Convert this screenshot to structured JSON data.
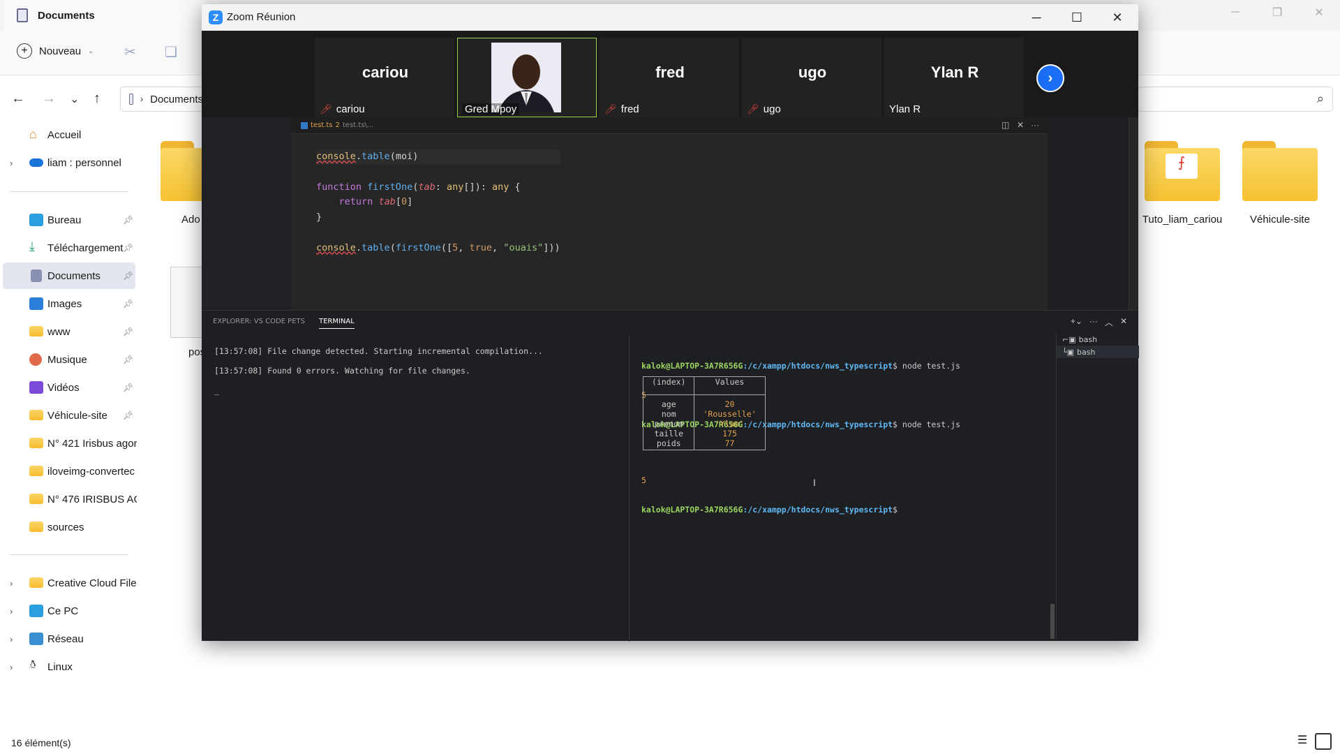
{
  "explorer": {
    "tab_title": "Documents",
    "toolbar": {
      "new_label": "Nouveau"
    },
    "address": "Documents",
    "sidebar": [
      {
        "label": "Accueil",
        "icon": "home-icon"
      },
      {
        "label": "liam : personnel",
        "icon": "cloud-icon"
      },
      {
        "label": "Bureau",
        "icon": "desktop-icon"
      },
      {
        "label": "Téléchargement",
        "icon": "download-icon"
      },
      {
        "label": "Documents",
        "icon": "documents-icon"
      },
      {
        "label": "Images",
        "icon": "images-icon"
      },
      {
        "label": "www",
        "icon": "folder-icon"
      },
      {
        "label": "Musique",
        "icon": "music-icon"
      },
      {
        "label": "Vidéos",
        "icon": "videos-icon"
      },
      {
        "label": "Véhicule-site",
        "icon": "folder-icon"
      },
      {
        "label": "N° 421 Irisbus agor",
        "icon": "folder-icon"
      },
      {
        "label": "iloveimg-convertec",
        "icon": "folder-icon"
      },
      {
        "label": "N° 476 IRISBUS AG",
        "icon": "folder-icon"
      },
      {
        "label": "sources",
        "icon": "folder-icon"
      },
      {
        "label": "Creative Cloud Files",
        "icon": "creative-cloud-icon"
      },
      {
        "label": "Ce PC",
        "icon": "pc-icon"
      },
      {
        "label": "Réseau",
        "icon": "network-icon"
      },
      {
        "label": "Linux",
        "icon": "linux-icon"
      }
    ],
    "files": [
      {
        "name": "Ado"
      },
      {
        "name": "pos"
      },
      {
        "name": "Tuto_liam_cariou"
      },
      {
        "name": "Véhicule-site"
      }
    ],
    "status": "16 élément(s)"
  },
  "zoom": {
    "title": "Zoom Réunion",
    "participants": [
      {
        "big": "cariou",
        "small": "cariou",
        "muted": true
      },
      {
        "big": "",
        "small": "Gred Mpoy",
        "muted": false,
        "video": true
      },
      {
        "big": "fred",
        "small": "fred",
        "muted": true
      },
      {
        "big": "ugo",
        "small": "ugo",
        "muted": true
      },
      {
        "big": "Ylan R",
        "small": "Ylan R",
        "muted": false
      }
    ]
  },
  "editor": {
    "tab_name": "test.ts",
    "tab_badge": "2",
    "tab_path": "test.ts\\..."
  },
  "terminal": {
    "tabs": [
      "EXPLORER: VS CODE PETS",
      "TERMINAL"
    ],
    "left_lines": [
      "[13:57:08] File change detected. Starting incremental compilation...",
      "[13:57:08] Found 0 errors. Watching for file changes.",
      "_"
    ],
    "prompt_user": "kalok@LAPTOP-3A7R656G",
    "prompt_path": ":/c/xampp/htdocs/nws_typescript",
    "command": "$ node test.js",
    "out1": "5",
    "table_headers": [
      "(index)",
      "Values"
    ],
    "table_keys": "age\nnom\nprenom\ntaille\npoids",
    "table_values": "20\n'Rousselle'\n'Ylan'\n175\n77",
    "out2": "5",
    "final_prompt": "$",
    "shells": [
      "bash",
      "bash"
    ]
  }
}
